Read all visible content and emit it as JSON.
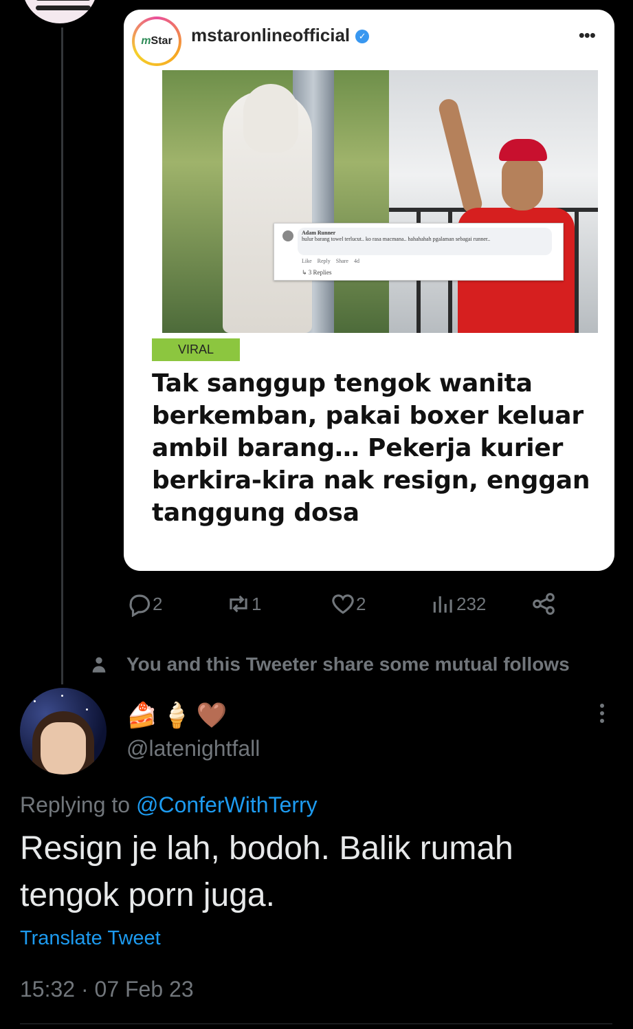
{
  "embedded_post": {
    "account_name": "mstaronlineofficial",
    "logo_text": "Star",
    "logo_prefix": "m",
    "more_icon": "ellipsis-horizontal-icon",
    "tag": "VIRAL",
    "headline": "Tak sanggup tengok wanita berkemban, pakai boxer keluar ambil barang… Pekerja kurier berkira-kira nak resign, enggan tanggung dosa",
    "screenshot_comment": {
      "name": "Adam Runner",
      "text": "hulur barang towel terlucut.. ko rasa macmana.. hahahahah pgalaman sebagai runner..",
      "actions": "Like Reply Share 4d",
      "replies": "↳ 3 Replies"
    }
  },
  "tweet_actions": {
    "replies": "2",
    "retweets": "1",
    "likes": "2",
    "views": "232"
  },
  "mutual_follows_text": "You and this Tweeter share some mutual follows",
  "reply": {
    "display_name_emoji": [
      "🍰",
      "🍦",
      "🤎"
    ],
    "handle": "@latenightfall",
    "replying_label": "Replying to",
    "replying_to": "@ConferWithTerry",
    "text": "Resign je lah, bodoh. Balik rumah tengok porn juga.",
    "translate_label": "Translate Tweet",
    "timestamp": "15:32 · 07 Feb 23"
  },
  "colors": {
    "background": "#000000",
    "text_primary": "#e7e9ea",
    "text_secondary": "#71767b",
    "link": "#1d9bf0",
    "viral_tag": "#8cc63f"
  }
}
